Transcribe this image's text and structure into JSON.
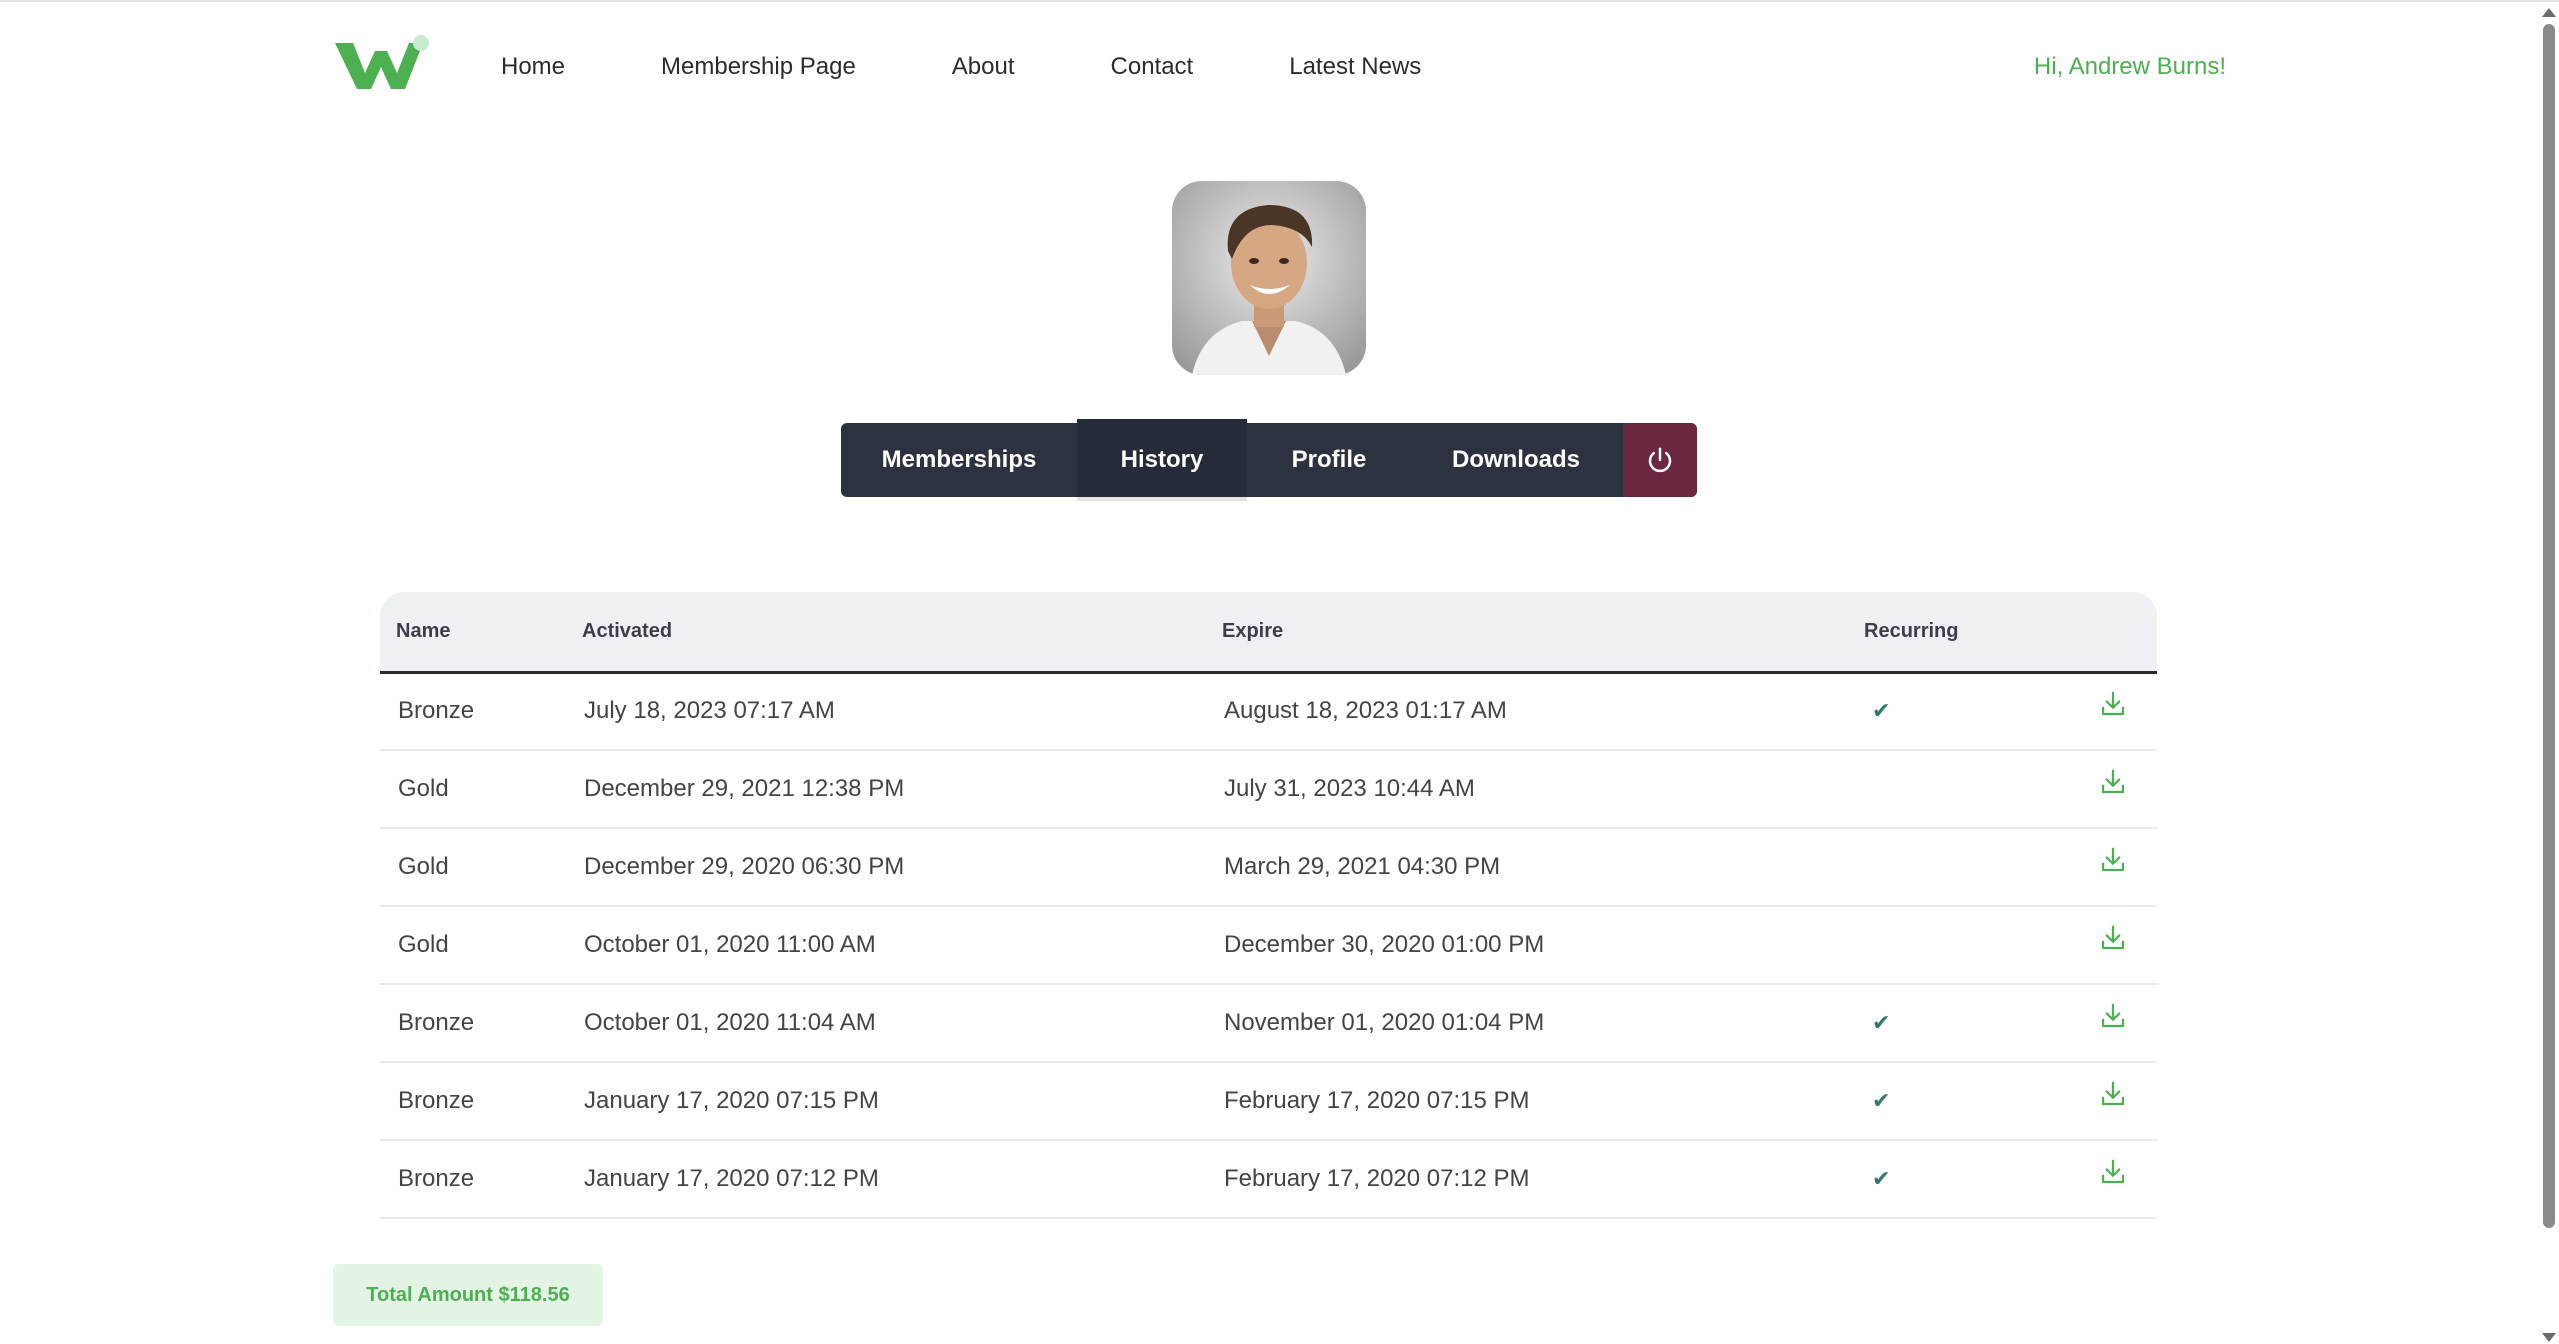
{
  "nav": {
    "items": [
      {
        "label": "Home"
      },
      {
        "label": "Membership Page"
      },
      {
        "label": "About"
      },
      {
        "label": "Contact"
      },
      {
        "label": "Latest News"
      }
    ],
    "greeting": "Hi, Andrew Burns!"
  },
  "tabs": {
    "memberships": "Memberships",
    "history": "History",
    "profile": "Profile",
    "downloads": "Downloads",
    "active": "History"
  },
  "table": {
    "headers": {
      "name": "Name",
      "activated": "Activated",
      "expire": "Expire",
      "recurring": "Recurring"
    },
    "rows": [
      {
        "name": "Bronze",
        "activated": "July 18, 2023 07:17 AM",
        "expire": "August 18, 2023 01:17 AM",
        "recurring": "✔"
      },
      {
        "name": "Gold",
        "activated": "December 29, 2021 12:38 PM",
        "expire": "July 31, 2023 10:44 AM",
        "recurring": ""
      },
      {
        "name": "Gold",
        "activated": "December 29, 2020 06:30 PM",
        "expire": "March 29, 2021 04:30 PM",
        "recurring": ""
      },
      {
        "name": "Gold",
        "activated": "October 01, 2020 11:00 AM",
        "expire": "December 30, 2020 01:00 PM",
        "recurring": ""
      },
      {
        "name": "Bronze",
        "activated": "October 01, 2020 11:04 AM",
        "expire": "November 01, 2020 01:04 PM",
        "recurring": "✔"
      },
      {
        "name": "Bronze",
        "activated": "January 17, 2020 07:15 PM",
        "expire": "February 17, 2020 07:15 PM",
        "recurring": "✔"
      },
      {
        "name": "Bronze",
        "activated": "January 17, 2020 07:12 PM",
        "expire": "February 17, 2020 07:12 PM",
        "recurring": "✔"
      }
    ]
  },
  "total": "Total Amount $118.56",
  "icons": {
    "logo": "w-logo",
    "logout": "power-icon",
    "download": "download-icon",
    "check": "check-icon"
  },
  "colors": {
    "accent": "#4caf50",
    "tabs_bg": "#2d3241",
    "logout_bg": "#6b2740",
    "total_bg": "#e3f4e5"
  }
}
